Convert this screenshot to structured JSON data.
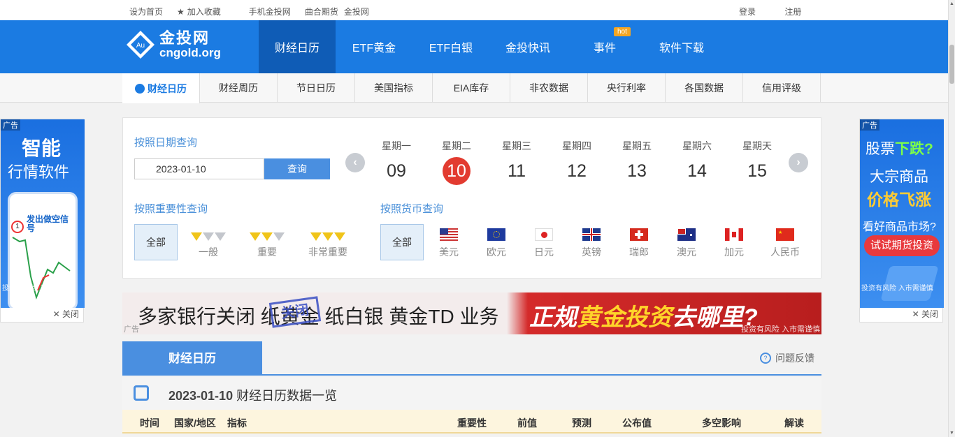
{
  "topbar": {
    "set_home": "设为首页",
    "add_fav": "加入收藏",
    "mobile": "手机金投网",
    "futures": "曲合期货",
    "site": "金投网",
    "login": "登录",
    "register": "注册"
  },
  "logo": {
    "cn": "金投网",
    "en": "cngold.org",
    "mark": "Au"
  },
  "nav": {
    "items": [
      {
        "label": "财经日历"
      },
      {
        "label": "ETF黄金"
      },
      {
        "label": "ETF白银"
      },
      {
        "label": "金投快讯"
      },
      {
        "label": "事件",
        "badge": "hot"
      },
      {
        "label": "软件下载"
      }
    ]
  },
  "subnav": {
    "items": [
      "财经日历",
      "财经周历",
      "节日日历",
      "美国指标",
      "EIA库存",
      "非农数据",
      "央行利率",
      "各国数据",
      "信用评级"
    ]
  },
  "date_query": {
    "label": "按照日期查询",
    "value": "2023-01-10",
    "button": "查询"
  },
  "days": [
    {
      "weekday": "星期一",
      "day": "09"
    },
    {
      "weekday": "星期二",
      "day": "10"
    },
    {
      "weekday": "星期三",
      "day": "11"
    },
    {
      "weekday": "星期四",
      "day": "12"
    },
    {
      "weekday": "星期五",
      "day": "13"
    },
    {
      "weekday": "星期六",
      "day": "14"
    },
    {
      "weekday": "星期天",
      "day": "15"
    }
  ],
  "importance": {
    "label": "按照重要性查询",
    "all": "全部",
    "levels": [
      "一般",
      "重要",
      "非常重要"
    ]
  },
  "currency": {
    "label": "按照货币查询",
    "all": "全部",
    "items": [
      "美元",
      "欧元",
      "日元",
      "英镑",
      "瑞郎",
      "澳元",
      "加元",
      "人民币"
    ]
  },
  "ad_left": {
    "tag": "广告",
    "line1": "智能",
    "line2": "行情软件",
    "signal": "发出做空信号",
    "circle": "1",
    "risk": "投资有风险 入市需谨慎",
    "close": "✕ 关闭"
  },
  "ad_right": {
    "tag": "广告",
    "line1a": "股票",
    "line1b": "下跌?",
    "line2": "大宗商品",
    "line3": "价格飞涨",
    "line4": "看好商品市场?",
    "button": "试试期货投资",
    "risk": "投资有风险 入市需谨慎",
    "close": "✕ 关闭"
  },
  "banner": {
    "text1": "多家银行关闭 纸黄金 纸白银 黄金TD 业务",
    "stamp": "关闭",
    "text2a": "正规",
    "text2b": "黄金投资",
    "text2c": "去哪里?",
    "tag": "广告",
    "risk": "投资有风险 入市需谨慎"
  },
  "tabs": {
    "active": "财经日历",
    "feedback": "问题反馈"
  },
  "table": {
    "date": "2023-01-10",
    "title": "财经日历数据一览",
    "columns": [
      "时间",
      "国家/地区",
      "指标",
      "重要性",
      "前值",
      "预测",
      "公布值",
      "多空影响",
      "解读"
    ]
  }
}
